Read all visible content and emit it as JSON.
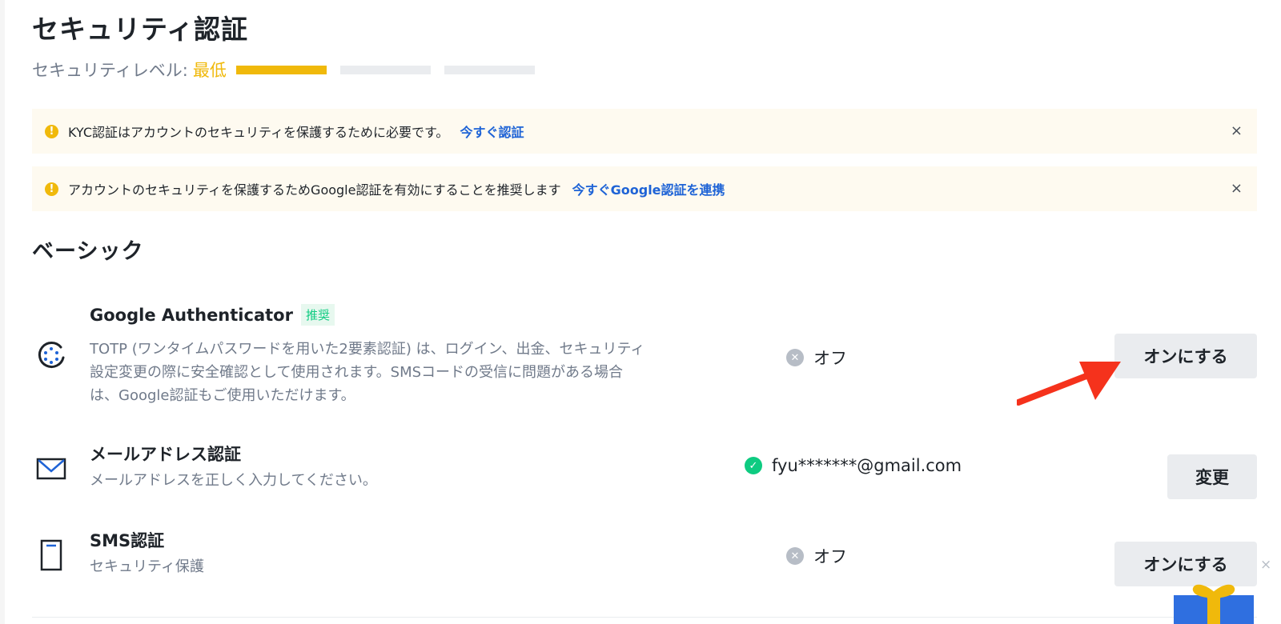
{
  "page": {
    "title": "セキュリティ認証",
    "security_level_label": "セキュリティレベル:",
    "security_level_value": "最低",
    "security_level_progress": 1,
    "security_level_total": 3
  },
  "alerts": [
    {
      "icon": "warning-icon",
      "message": "KYC認証はアカウントのセキュリティを保護するために必要です。",
      "link": "今すぐ認証",
      "close": "×"
    },
    {
      "icon": "warning-icon",
      "message": "アカウントのセキュリティを保護するためGoogle認証を有効にすることを推奨します",
      "link": "今すぐGoogle認証を連携",
      "close": "×"
    }
  ],
  "section_title": "ベーシック",
  "methods": [
    {
      "icon": "google-authenticator-icon",
      "name": "Google Authenticator",
      "tag": "推奨",
      "description_lines": [
        "TOTP (ワンタイムパスワードを用いた2要素認証) は、ログイン、出金、セキュリティ",
        "設定変更の際に安全確認として使用されます。SMSコードの受信に問題がある場合",
        "は、Google認証もご使用いただけます。"
      ],
      "status": "オフ",
      "status_icon": "off-icon",
      "button": "オンにする"
    },
    {
      "icon": "mail-icon",
      "name": "メールアドレス認証",
      "description_lines": [
        "メールアドレスを正しく入力してください。"
      ],
      "status": "fyu*******@gmail.com",
      "status_icon": "check-icon",
      "button": "変更"
    },
    {
      "icon": "phone-icon",
      "name": "SMS認証",
      "description_lines": [
        "セキュリティ保護"
      ],
      "status": "オフ",
      "status_icon": "off-icon",
      "button": "オンにする"
    }
  ],
  "overlay": {
    "float_close": "×"
  },
  "colors": {
    "accent": "#f0b90b",
    "link": "#1e63d6",
    "success": "#0ecb81",
    "arrow": "#f5321c"
  }
}
